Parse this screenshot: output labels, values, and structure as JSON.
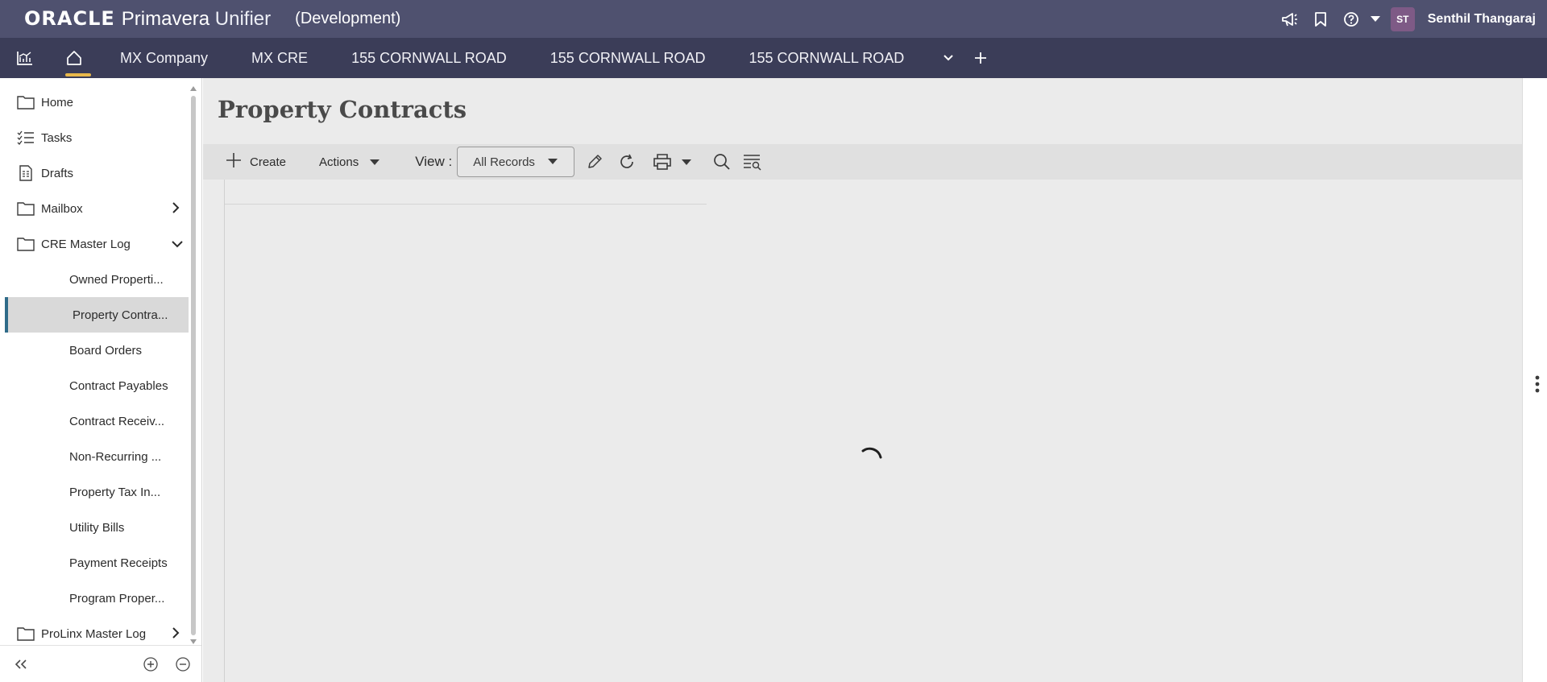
{
  "header": {
    "brand_oracle": "ORACLE",
    "brand_product_bold": "Primavera",
    "brand_product_thin": "Unifier",
    "environment": "(Development)",
    "user_initials": "ST",
    "user_name": "Senthil Thangaraj",
    "icons": [
      "megaphone-icon",
      "bookmark-icon",
      "help-icon",
      "chevron-down-icon"
    ]
  },
  "tabs": {
    "items": [
      {
        "label": "MX Company"
      },
      {
        "label": "MX CRE"
      },
      {
        "label": "155 CORNWALL ROAD"
      },
      {
        "label": "155 CORNWALL ROAD"
      },
      {
        "label": "155 CORNWALL ROAD"
      }
    ],
    "accent_color": "#e8b84a"
  },
  "sidebar": {
    "items": [
      {
        "label": "Home",
        "icon": "folder-icon"
      },
      {
        "label": "Tasks",
        "icon": "tasks-icon"
      },
      {
        "label": "Drafts",
        "icon": "drafts-icon"
      },
      {
        "label": "Mailbox",
        "icon": "folder-icon",
        "expander": "chevron-right-icon"
      },
      {
        "label": "CRE Master Log",
        "icon": "folder-icon",
        "expander": "chevron-down-icon"
      }
    ],
    "sub_items": [
      {
        "label": "Owned Properti..."
      },
      {
        "label": "Property Contra...",
        "active": true
      },
      {
        "label": "Board Orders"
      },
      {
        "label": "Contract Payables"
      },
      {
        "label": "Contract Receiv..."
      },
      {
        "label": "Non-Recurring ..."
      },
      {
        "label": "Property Tax In..."
      },
      {
        "label": "Utility Bills"
      },
      {
        "label": "Payment Receipts"
      },
      {
        "label": "Program Proper..."
      }
    ],
    "last_item": {
      "label": "ProLinx Master Log",
      "icon": "folder-icon",
      "expander": "chevron-right-icon"
    },
    "active_color": "#2f6b89"
  },
  "main": {
    "title": "Property Contracts",
    "toolbar": {
      "create_label": "Create",
      "actions_label": "Actions",
      "view_label": "View :",
      "view_value": "All Records"
    },
    "loading": true
  }
}
